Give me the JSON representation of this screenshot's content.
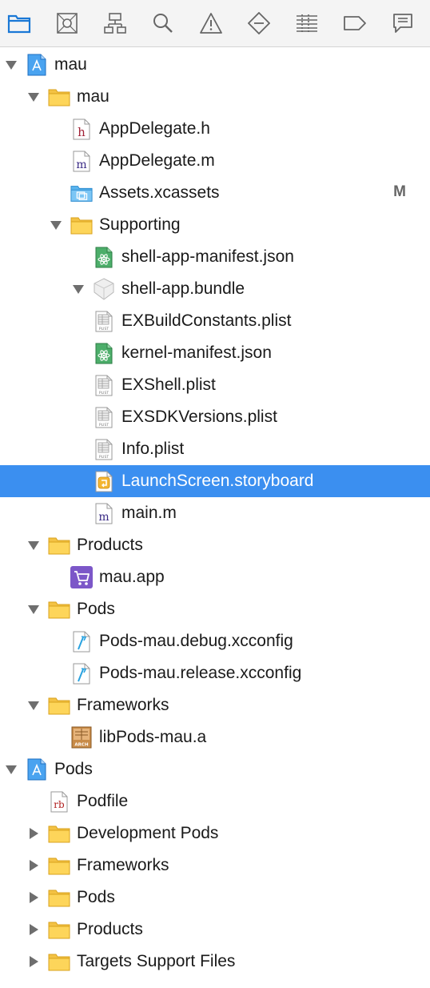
{
  "toolbar": {
    "icons": [
      {
        "name": "project-navigator-icon",
        "active": true
      },
      {
        "name": "source-control-navigator-icon"
      },
      {
        "name": "symbol-navigator-icon"
      },
      {
        "name": "find-navigator-icon"
      },
      {
        "name": "issue-navigator-icon"
      },
      {
        "name": "test-navigator-icon"
      },
      {
        "name": "debug-navigator-icon"
      },
      {
        "name": "breakpoint-navigator-icon"
      },
      {
        "name": "report-navigator-icon"
      }
    ],
    "accent": "#1a78d6"
  },
  "tree": {
    "selection_color": "#3b8ff0",
    "rows": [
      {
        "label": "mau",
        "icon": "xcode-project-icon",
        "disclosure": "expanded",
        "depth": 0
      },
      {
        "label": "mau",
        "icon": "folder-icon",
        "disclosure": "expanded",
        "depth": 1
      },
      {
        "label": "AppDelegate.h",
        "icon": "header-file-icon",
        "icon_text": "h",
        "disclosure": "none",
        "depth": 2
      },
      {
        "label": "AppDelegate.m",
        "icon": "objc-file-icon",
        "icon_text": "m",
        "disclosure": "none",
        "depth": 2
      },
      {
        "label": "Assets.xcassets",
        "icon": "asset-catalog-icon",
        "disclosure": "none",
        "depth": 2,
        "badge": "M"
      },
      {
        "label": "Supporting",
        "icon": "folder-icon",
        "disclosure": "expanded",
        "depth": 2
      },
      {
        "label": "shell-app-manifest.json",
        "icon": "json-file-icon",
        "disclosure": "none",
        "depth": 3
      },
      {
        "label": "shell-app.bundle",
        "icon": "bundle-icon",
        "disclosure": "expanded",
        "depth": 3
      },
      {
        "label": "EXBuildConstants.plist",
        "icon": "plist-file-icon",
        "icon_text": "PLIST",
        "disclosure": "none",
        "depth": 3
      },
      {
        "label": "kernel-manifest.json",
        "icon": "json-file-icon",
        "disclosure": "none",
        "depth": 3
      },
      {
        "label": "EXShell.plist",
        "icon": "plist-file-icon",
        "icon_text": "PLIST",
        "disclosure": "none",
        "depth": 3
      },
      {
        "label": "EXSDKVersions.plist",
        "icon": "plist-file-icon",
        "icon_text": "PLIST",
        "disclosure": "none",
        "depth": 3
      },
      {
        "label": "Info.plist",
        "icon": "plist-file-icon",
        "icon_text": "PLIST",
        "disclosure": "none",
        "depth": 3
      },
      {
        "label": "LaunchScreen.storyboard",
        "icon": "storyboard-file-icon",
        "disclosure": "none",
        "depth": 3,
        "selected": true
      },
      {
        "label": "main.m",
        "icon": "objc-file-icon",
        "icon_text": "m",
        "disclosure": "none",
        "depth": 3
      },
      {
        "label": "Products",
        "icon": "folder-icon",
        "disclosure": "expanded",
        "depth": 1
      },
      {
        "label": "mau.app",
        "icon": "app-product-icon",
        "disclosure": "none",
        "depth": 2
      },
      {
        "label": "Pods",
        "icon": "folder-icon",
        "disclosure": "expanded",
        "depth": 1
      },
      {
        "label": "Pods-mau.debug.xcconfig",
        "icon": "xcconfig-file-icon",
        "disclosure": "none",
        "depth": 2
      },
      {
        "label": "Pods-mau.release.xcconfig",
        "icon": "xcconfig-file-icon",
        "disclosure": "none",
        "depth": 2
      },
      {
        "label": "Frameworks",
        "icon": "folder-icon",
        "disclosure": "expanded",
        "depth": 1
      },
      {
        "label": "libPods-mau.a",
        "icon": "static-library-icon",
        "icon_text": "ARCH",
        "disclosure": "none",
        "depth": 2
      },
      {
        "label": "Pods",
        "icon": "xcode-project-icon",
        "disclosure": "expanded",
        "depth": 0
      },
      {
        "label": "Podfile",
        "icon": "ruby-file-icon",
        "icon_text": "rb",
        "disclosure": "none",
        "depth": 1
      },
      {
        "label": "Development Pods",
        "icon": "folder-icon",
        "disclosure": "collapsed",
        "depth": 1
      },
      {
        "label": "Frameworks",
        "icon": "folder-icon",
        "disclosure": "collapsed",
        "depth": 1
      },
      {
        "label": "Pods",
        "icon": "folder-icon",
        "disclosure": "collapsed",
        "depth": 1
      },
      {
        "label": "Products",
        "icon": "folder-icon",
        "disclosure": "collapsed",
        "depth": 1
      },
      {
        "label": "Targets Support Files",
        "icon": "folder-icon",
        "disclosure": "collapsed",
        "depth": 1
      }
    ]
  }
}
